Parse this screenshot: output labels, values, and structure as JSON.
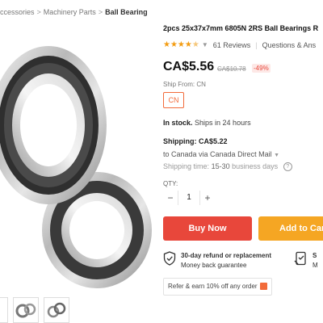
{
  "breadcrumb": {
    "items": [
      "ccessories",
      "Machinery Parts",
      "Ball Bearing"
    ],
    "separator": ">"
  },
  "product": {
    "title": "2pcs 25x37x7mm 6805N 2RS Ball Bearings R",
    "rating_stars": 4.5,
    "reviews": "61 Reviews",
    "questions": "Questions & Ans",
    "price": "CA$5.56",
    "old_price": "CA$10.78",
    "discount": "-49%",
    "ship_from_label": "Ship From: CN",
    "ship_from_option": "CN",
    "stock_status": "In stock.",
    "stock_detail": "Ships in 24 hours",
    "shipping_label": "Shipping: CA$5.22",
    "shipping_to": "to Canada via Canada Direct Mail",
    "shipping_time_label": "Shipping time:",
    "shipping_time_value": "15-30",
    "shipping_time_unit": "business days",
    "qty_label": "QTY:",
    "qty_value": "1"
  },
  "actions": {
    "buy_now": "Buy Now",
    "add_to_cart": "Add to Car"
  },
  "guarantees": {
    "refund_title": "30-day refund or replacement",
    "refund_sub": "Money back guarantee",
    "secure_title": "S",
    "secure_sub": "M"
  },
  "refer": {
    "text": "Refer & earn 10% off any order"
  },
  "colors": {
    "buy_now": "#e8473b",
    "add_to_cart": "#f5a623",
    "accent": "#f26b3a",
    "stars": "#f39c12"
  },
  "icons": [
    "shield-check-icon",
    "secure-payment-icon",
    "gift-icon",
    "question-icon",
    "chevron-down-icon"
  ]
}
